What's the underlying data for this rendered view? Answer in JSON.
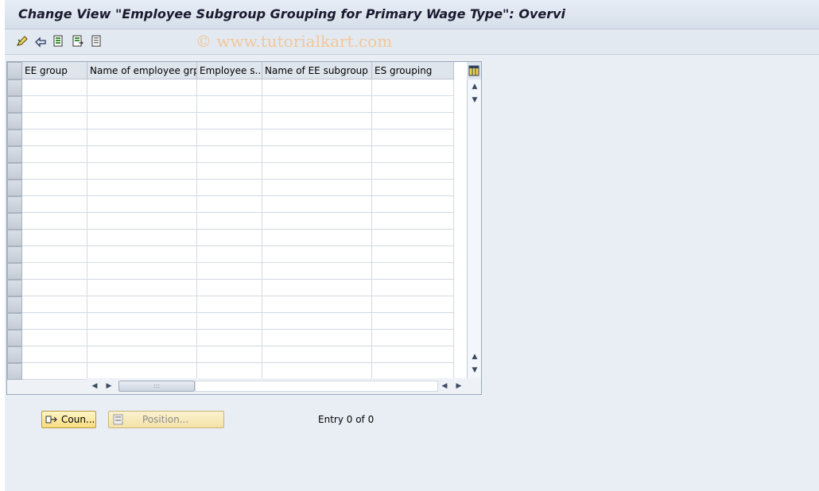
{
  "window": {
    "title": "Change View \"Employee Subgroup Grouping for Primary Wage Type\": Overvi"
  },
  "toolbar": {
    "icons": [
      "edit-pencil-icon",
      "undo-icon",
      "select-all-icon",
      "select-block-icon",
      "deselect-all-icon"
    ],
    "watermark": "© www.tutorialkart.com"
  },
  "table": {
    "columns": [
      "EE group",
      "Name of employee grp",
      "Employee s...",
      "Name of EE subgroup",
      "ES grouping"
    ],
    "rows_visible": 18,
    "rows": []
  },
  "buttons": {
    "count_label": "Coun...",
    "position_label": "Position..."
  },
  "status": {
    "entry_text": "Entry 0 of 0"
  },
  "colors": {
    "button_yellow": "#f7dc7f",
    "header_bg": "#dfe5ec",
    "page_bg": "#e9eef5"
  }
}
